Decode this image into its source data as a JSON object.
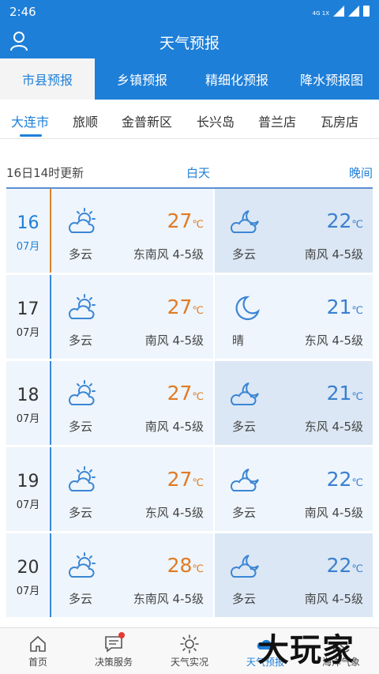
{
  "status": {
    "time": "2:46",
    "network": "4G 1X"
  },
  "app": {
    "title": "天气预报"
  },
  "tabs": [
    {
      "label": "市县预报",
      "active": true
    },
    {
      "label": "乡镇预报"
    },
    {
      "label": "精细化预报"
    },
    {
      "label": "降水预报图"
    }
  ],
  "cities": [
    "大连市",
    "旅顺",
    "金普新区",
    "长兴岛",
    "普兰店",
    "瓦房店"
  ],
  "header": {
    "updated": "16日14时更新",
    "day": "白天",
    "night": "晚间"
  },
  "unit": "℃",
  "days": [
    {
      "date": "16",
      "month": "07月",
      "day": {
        "weather": "多云",
        "icon": "partly-cloudy-day-icon",
        "temp": "27",
        "wind": "东南风  4-5级"
      },
      "night": {
        "weather": "多云",
        "icon": "partly-cloudy-night-icon",
        "temp": "22",
        "wind": "南风  4-5级"
      }
    },
    {
      "date": "17",
      "month": "07月",
      "day": {
        "weather": "多云",
        "icon": "partly-cloudy-day-icon",
        "temp": "27",
        "wind": "南风  4-5级"
      },
      "night": {
        "weather": "晴",
        "icon": "moon-icon",
        "temp": "21",
        "wind": "东风  4-5级"
      }
    },
    {
      "date": "18",
      "month": "07月",
      "day": {
        "weather": "多云",
        "icon": "partly-cloudy-day-icon",
        "temp": "27",
        "wind": "南风  4-5级"
      },
      "night": {
        "weather": "多云",
        "icon": "partly-cloudy-night-icon",
        "temp": "21",
        "wind": "东风  4-5级"
      }
    },
    {
      "date": "19",
      "month": "07月",
      "day": {
        "weather": "多云",
        "icon": "partly-cloudy-day-icon",
        "temp": "27",
        "wind": "东风  4-5级"
      },
      "night": {
        "weather": "多云",
        "icon": "partly-cloudy-night-icon",
        "temp": "22",
        "wind": "南风  4-5级"
      }
    },
    {
      "date": "20",
      "month": "07月",
      "day": {
        "weather": "多云",
        "icon": "partly-cloudy-day-icon",
        "temp": "28",
        "wind": "东南风  4-5级"
      },
      "night": {
        "weather": "多云",
        "icon": "partly-cloudy-night-icon",
        "temp": "22",
        "wind": "南风  4-5级"
      }
    }
  ],
  "nav": [
    {
      "label": "首页",
      "icon": "home-icon"
    },
    {
      "label": "决策服务",
      "icon": "message-icon"
    },
    {
      "label": "天气实况",
      "icon": "sun-icon"
    },
    {
      "label": "天气预报",
      "icon": "cloud-icon",
      "active": true
    },
    {
      "label": "海洋气象",
      "icon": "wave-icon"
    }
  ],
  "watermark": "大玩家",
  "colors": {
    "primary": "#1e7fd8",
    "day_temp": "#e07b24",
    "night_temp": "#3a80d0",
    "today_marker": "#e0802a"
  }
}
